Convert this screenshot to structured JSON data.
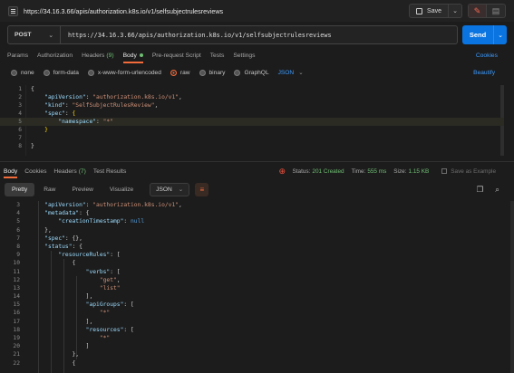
{
  "top": {
    "url_title": "https://34.16.3.66/apis/authorization.k8s.io/v1/selfsubjectrulesreviews",
    "save_label": "Save",
    "save_caret": "⌄"
  },
  "request": {
    "method": "POST",
    "method_caret": "⌄",
    "url": "https://34.16.3.66/apis/authorization.k8s.io/v1/selfsubjectrulesreviews",
    "send_label": "Send",
    "send_caret": "⌄"
  },
  "req_tabs": {
    "params": "Params",
    "authorization": "Authorization",
    "headers": "Headers",
    "headers_count": "(9)",
    "body": "Body",
    "prerequest": "Pre-request Script",
    "tests": "Tests",
    "settings": "Settings",
    "cookies": "Cookies"
  },
  "body_types": {
    "none": "none",
    "form_data": "form-data",
    "urlencoded": "x-www-form-urlencoded",
    "raw": "raw",
    "binary": "binary",
    "graphql": "GraphQL",
    "format": "JSON",
    "format_caret": "⌄",
    "beautify": "Beautify"
  },
  "request_body": {
    "lines": [
      {
        "n": "1",
        "parts": [
          [
            "p",
            "{"
          ]
        ]
      },
      {
        "n": "2",
        "parts": [
          [
            "p",
            "    "
          ],
          [
            "k",
            "\"apiVersion\""
          ],
          [
            "p",
            ": "
          ],
          [
            "s",
            "\"authorization.k8s.io/v1\""
          ],
          [
            "p",
            ","
          ]
        ]
      },
      {
        "n": "3",
        "parts": [
          [
            "p",
            "    "
          ],
          [
            "k",
            "\"kind\""
          ],
          [
            "p",
            ": "
          ],
          [
            "s",
            "\"SelfSubjectRulesReview\""
          ],
          [
            "p",
            ","
          ]
        ]
      },
      {
        "n": "4",
        "parts": [
          [
            "p",
            "    "
          ],
          [
            "k",
            "\"spec\""
          ],
          [
            "p",
            ": "
          ],
          [
            "b",
            "{"
          ]
        ]
      },
      {
        "n": "5",
        "parts": [
          [
            "p",
            "        "
          ],
          [
            "k",
            "\"namespace\""
          ],
          [
            "p",
            ": "
          ],
          [
            "s",
            "\"*\""
          ]
        ]
      },
      {
        "n": "6",
        "parts": [
          [
            "p",
            "    "
          ],
          [
            "b",
            "}"
          ]
        ]
      },
      {
        "n": "7",
        "parts": []
      },
      {
        "n": "8",
        "parts": [
          [
            "p",
            "}"
          ]
        ]
      }
    ]
  },
  "res_tabs": {
    "body": "Body",
    "cookies": "Cookies",
    "headers": "Headers",
    "headers_count": "(7)",
    "test_results": "Test Results"
  },
  "res_status": {
    "status_label": "Status:",
    "status_value": "201 Created",
    "time_label": "Time:",
    "time_value": "555 ms",
    "size_label": "Size:",
    "size_value": "1.15 KB",
    "save_example": "Save as Example"
  },
  "res_toolbar": {
    "pretty": "Pretty",
    "raw": "Raw",
    "preview": "Preview",
    "visualize": "Visualize",
    "format": "JSON",
    "format_caret": "⌄"
  },
  "response_body": {
    "lines": [
      {
        "n": "3",
        "parts": [
          [
            "p",
            "    "
          ],
          [
            "k",
            "\"apiVersion\""
          ],
          [
            "p",
            ": "
          ],
          [
            "s",
            "\"authorization.k8s.io/v1\""
          ],
          [
            "p",
            ","
          ]
        ]
      },
      {
        "n": "4",
        "parts": [
          [
            "p",
            "    "
          ],
          [
            "k",
            "\"metadata\""
          ],
          [
            "p",
            ": {"
          ]
        ]
      },
      {
        "n": "5",
        "parts": [
          [
            "p",
            "        "
          ],
          [
            "k",
            "\"creationTimestamp\""
          ],
          [
            "p",
            ": "
          ],
          [
            "n",
            "null"
          ]
        ]
      },
      {
        "n": "6",
        "parts": [
          [
            "p",
            "    },"
          ]
        ]
      },
      {
        "n": "7",
        "parts": [
          [
            "p",
            "    "
          ],
          [
            "k",
            "\"spec\""
          ],
          [
            "p",
            ": {},"
          ]
        ]
      },
      {
        "n": "8",
        "parts": [
          [
            "p",
            "    "
          ],
          [
            "k",
            "\"status\""
          ],
          [
            "p",
            ": {"
          ]
        ]
      },
      {
        "n": "9",
        "parts": [
          [
            "p",
            "        "
          ],
          [
            "k",
            "\"resourceRules\""
          ],
          [
            "p",
            ": ["
          ]
        ]
      },
      {
        "n": "10",
        "parts": [
          [
            "p",
            "            {"
          ]
        ]
      },
      {
        "n": "11",
        "parts": [
          [
            "p",
            "                "
          ],
          [
            "k",
            "\"verbs\""
          ],
          [
            "p",
            ": ["
          ]
        ]
      },
      {
        "n": "12",
        "parts": [
          [
            "p",
            "                    "
          ],
          [
            "s",
            "\"get\""
          ],
          [
            "p",
            ","
          ]
        ]
      },
      {
        "n": "13",
        "parts": [
          [
            "p",
            "                    "
          ],
          [
            "s",
            "\"list\""
          ]
        ]
      },
      {
        "n": "14",
        "parts": [
          [
            "p",
            "                ],"
          ]
        ]
      },
      {
        "n": "15",
        "parts": [
          [
            "p",
            "                "
          ],
          [
            "k",
            "\"apiGroups\""
          ],
          [
            "p",
            ": ["
          ]
        ]
      },
      {
        "n": "16",
        "parts": [
          [
            "p",
            "                    "
          ],
          [
            "s",
            "\"*\""
          ]
        ]
      },
      {
        "n": "17",
        "parts": [
          [
            "p",
            "                ],"
          ]
        ]
      },
      {
        "n": "18",
        "parts": [
          [
            "p",
            "                "
          ],
          [
            "k",
            "\"resources\""
          ],
          [
            "p",
            ": ["
          ]
        ]
      },
      {
        "n": "19",
        "parts": [
          [
            "p",
            "                    "
          ],
          [
            "s",
            "\"*\""
          ]
        ]
      },
      {
        "n": "20",
        "parts": [
          [
            "p",
            "                ]"
          ]
        ]
      },
      {
        "n": "21",
        "parts": [
          [
            "p",
            "            },"
          ]
        ]
      },
      {
        "n": "22",
        "parts": [
          [
            "p",
            "            {"
          ]
        ]
      }
    ]
  },
  "colors": {
    "accent": "#f26b3a",
    "send": "#0a74e0",
    "link": "#3b9bff",
    "status_ok": "#6fbf73",
    "key": "#9cdcfe",
    "string": "#ce9178"
  },
  "icons": [
    "http-request-icon",
    "save-icon",
    "pencil-icon",
    "document-icon",
    "globe-error-icon",
    "copy-icon",
    "search-icon",
    "wrap-lines-icon"
  ]
}
